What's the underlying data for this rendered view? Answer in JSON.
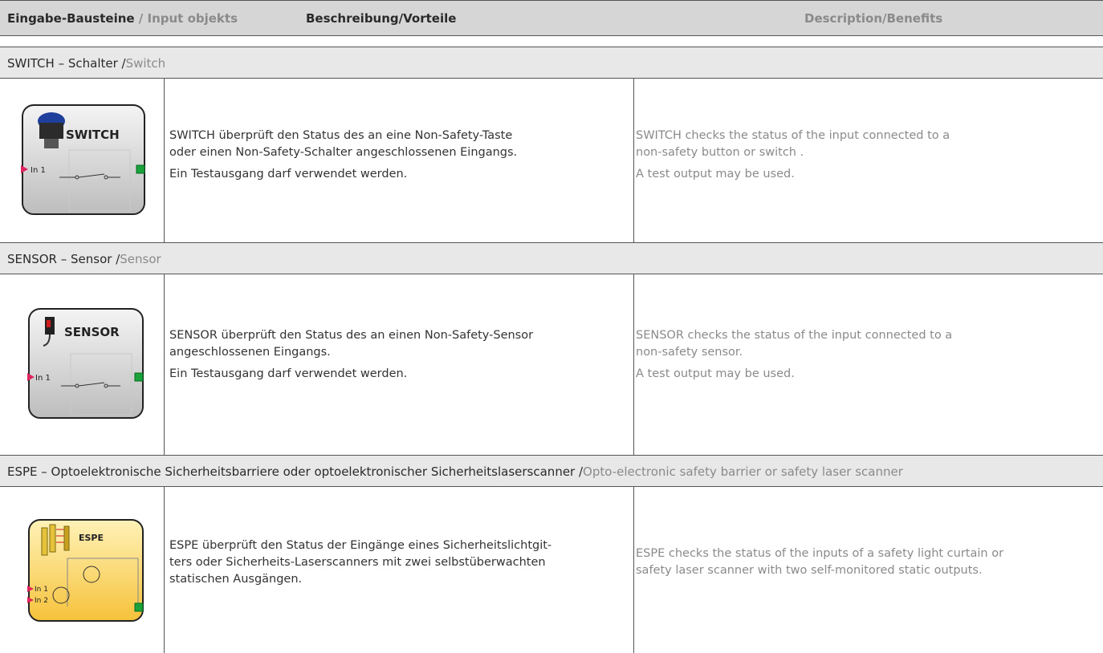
{
  "header": {
    "col1_de": "Eingabe-Bausteine",
    "col1_sep": " / ",
    "col1_en": "Input objekts",
    "col2": "Beschreibung/Vorteile",
    "col3": "Description/Benefits"
  },
  "sections": [
    {
      "title_de": "SWITCH – Schalter /",
      "title_en": "Switch",
      "icon": {
        "name": "switch-block-icon",
        "label": "SWITCH",
        "inputs": [
          "In 1"
        ]
      },
      "de": [
        "SWITCH überprüft den Status des an eine Non-Safety-Taste oder einen Non-Safety-Schalter angeschlossenen Eingangs.",
        "Ein Testausgang darf verwendet werden."
      ],
      "de_lines": [
        [
          "SWITCH überprüft den Status des an eine Non-Safety-Taste",
          "oder einen Non-Safety-Schalter angeschlossenen Eingangs."
        ],
        [
          "Ein Testausgang darf verwendet werden."
        ]
      ],
      "en_lines": [
        [
          "SWITCH checks the status of the input connected to a",
          "non-safety button or switch ."
        ],
        [
          "A test output may be used."
        ]
      ]
    },
    {
      "title_de": "SENSOR – Sensor /",
      "title_en": "Sensor",
      "icon": {
        "name": "sensor-block-icon",
        "label": "SENSOR",
        "inputs": [
          "In 1"
        ]
      },
      "de_lines": [
        [
          "SENSOR überprüft den Status des an einen Non-Safety-Sensor",
          "angeschlossenen Eingangs."
        ],
        [
          "Ein Testausgang darf verwendet werden."
        ]
      ],
      "en_lines": [
        [
          "SENSOR checks the status of the input connected to a",
          "non-safety sensor."
        ],
        [
          "A test output may be used."
        ]
      ]
    },
    {
      "title_de": "ESPE – Optoelektronische Sicherheitsbarriere oder optoelektronischer Sicherheitslaserscanner /",
      "title_en": "Opto-electronic safety barrier or safety laser scanner",
      "icon": {
        "name": "espe-block-icon",
        "label": "ESPE",
        "inputs": [
          "In 1",
          "In 2"
        ]
      },
      "de_lines": [
        [
          "ESPE überprüft den Status der Eingänge eines Sicherheitslichtgit-",
          "ters oder Sicherheits-Laserscanners mit zwei selbstüberwachten",
          "statischen Ausgängen."
        ]
      ],
      "en_lines": [
        [
          "ESPE checks the status of the inputs of a safety light curtain or",
          "safety laser scanner with two self-monitored static outputs."
        ]
      ]
    }
  ],
  "colors": {
    "header_bg": "#d6d6d6",
    "section_bg": "#e8e8e8",
    "english_text": "#8a8a8a",
    "port_input": "#e0245e",
    "port_output": "#1aa33a",
    "espe_block": "#f6c23a"
  }
}
